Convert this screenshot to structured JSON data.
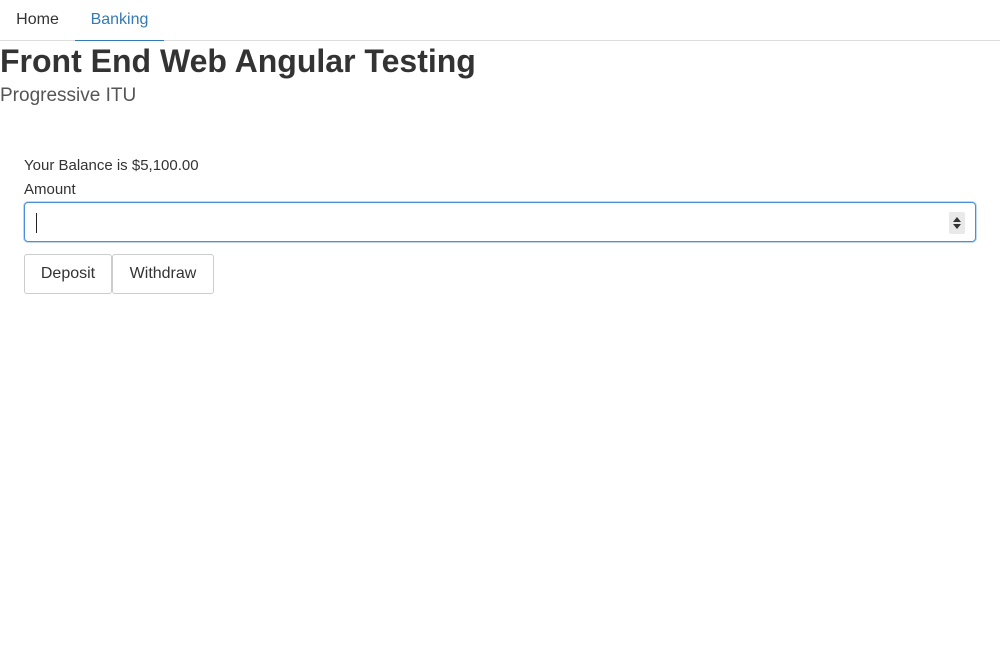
{
  "nav": {
    "tabs": [
      {
        "label": "Home",
        "active": false
      },
      {
        "label": "Banking",
        "active": true
      }
    ]
  },
  "header": {
    "title": "Front End Web Angular Testing",
    "subtitle": "Progressive ITU"
  },
  "banking": {
    "balance_text": "Your Balance is $5,100.00",
    "amount_label": "Amount",
    "amount_value": "",
    "deposit_label": "Deposit",
    "withdraw_label": "Withdraw"
  },
  "colors": {
    "accent": "#337ab7",
    "text": "#333333",
    "border": "#cccccc",
    "focus": "#4a90d9"
  }
}
